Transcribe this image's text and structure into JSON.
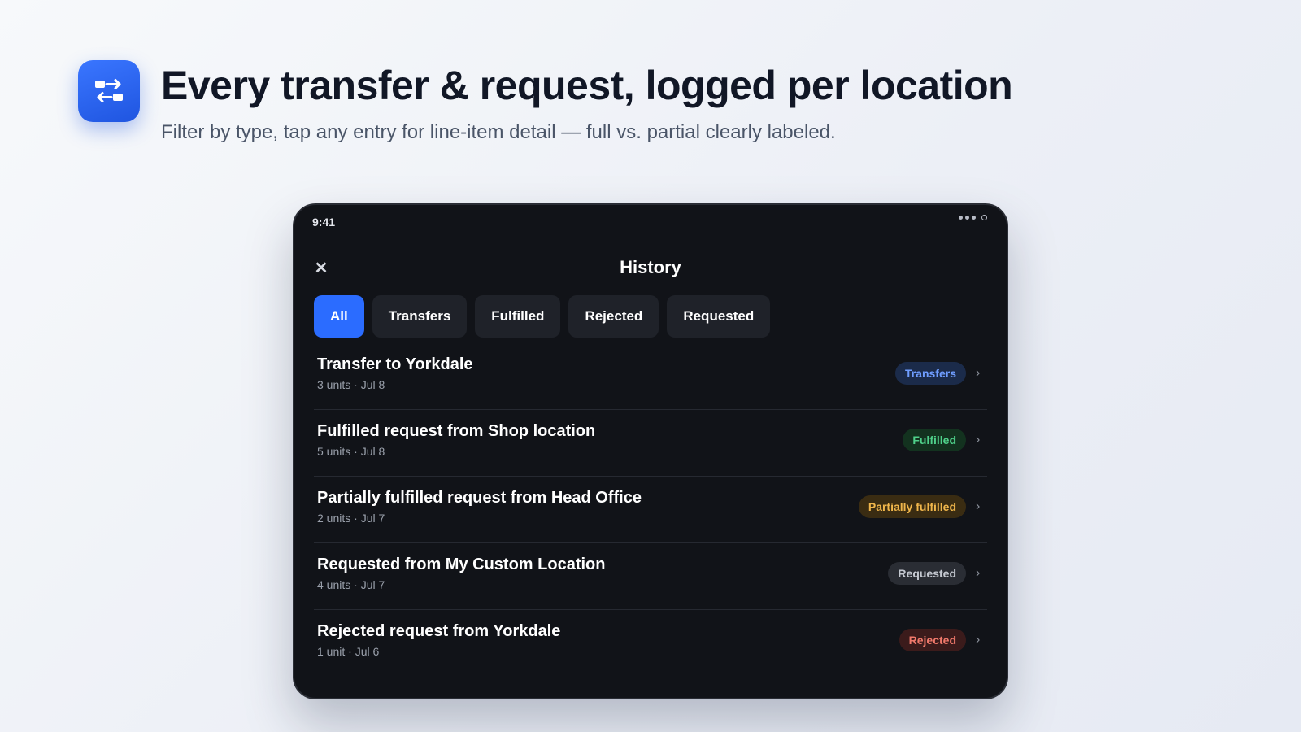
{
  "hero": {
    "icon": "transfer-arrows-icon",
    "headline": "Every transfer & request, logged per location",
    "subhead": "Filter by type, tap any entry for line-item detail — full vs. partial clearly labeled."
  },
  "status_bar": {
    "time": "9:41"
  },
  "screen": {
    "title": "History",
    "close_icon": "close-icon",
    "filters": [
      {
        "label": "All",
        "active": true
      },
      {
        "label": "Transfers",
        "active": false
      },
      {
        "label": "Fulfilled",
        "active": false
      },
      {
        "label": "Rejected",
        "active": false
      },
      {
        "label": "Requested",
        "active": false
      }
    ],
    "entries": [
      {
        "title": "Transfer to Yorkdale",
        "subtitle": "3 units · Jul 8",
        "badge": "Transfers",
        "badge_bg": "#1b2b4a",
        "badge_fg": "#6f9dff"
      },
      {
        "title": "Fulfilled request from Shop location",
        "subtitle": "5 units · Jul 8",
        "badge": "Fulfilled",
        "badge_bg": "#13321f",
        "badge_fg": "#4fd08a"
      },
      {
        "title": "Partially fulfilled request from Head Office",
        "subtitle": "2 units · Jul 7",
        "badge": "Partially fulfilled",
        "badge_bg": "#3a2c12",
        "badge_fg": "#f0b64b"
      },
      {
        "title": "Requested from My Custom Location",
        "subtitle": "4 units · Jul 7",
        "badge": "Requested",
        "badge_bg": "#2a2d34",
        "badge_fg": "#c4c8d0"
      },
      {
        "title": "Rejected request from Yorkdale",
        "subtitle": "1 unit · Jul 6",
        "badge": "Rejected",
        "badge_bg": "#3b1b1b",
        "badge_fg": "#f0796b"
      }
    ]
  },
  "colors": {
    "accent": "#2b6cff",
    "device_bg": "#111318",
    "chip_bg": "#1f2229"
  }
}
